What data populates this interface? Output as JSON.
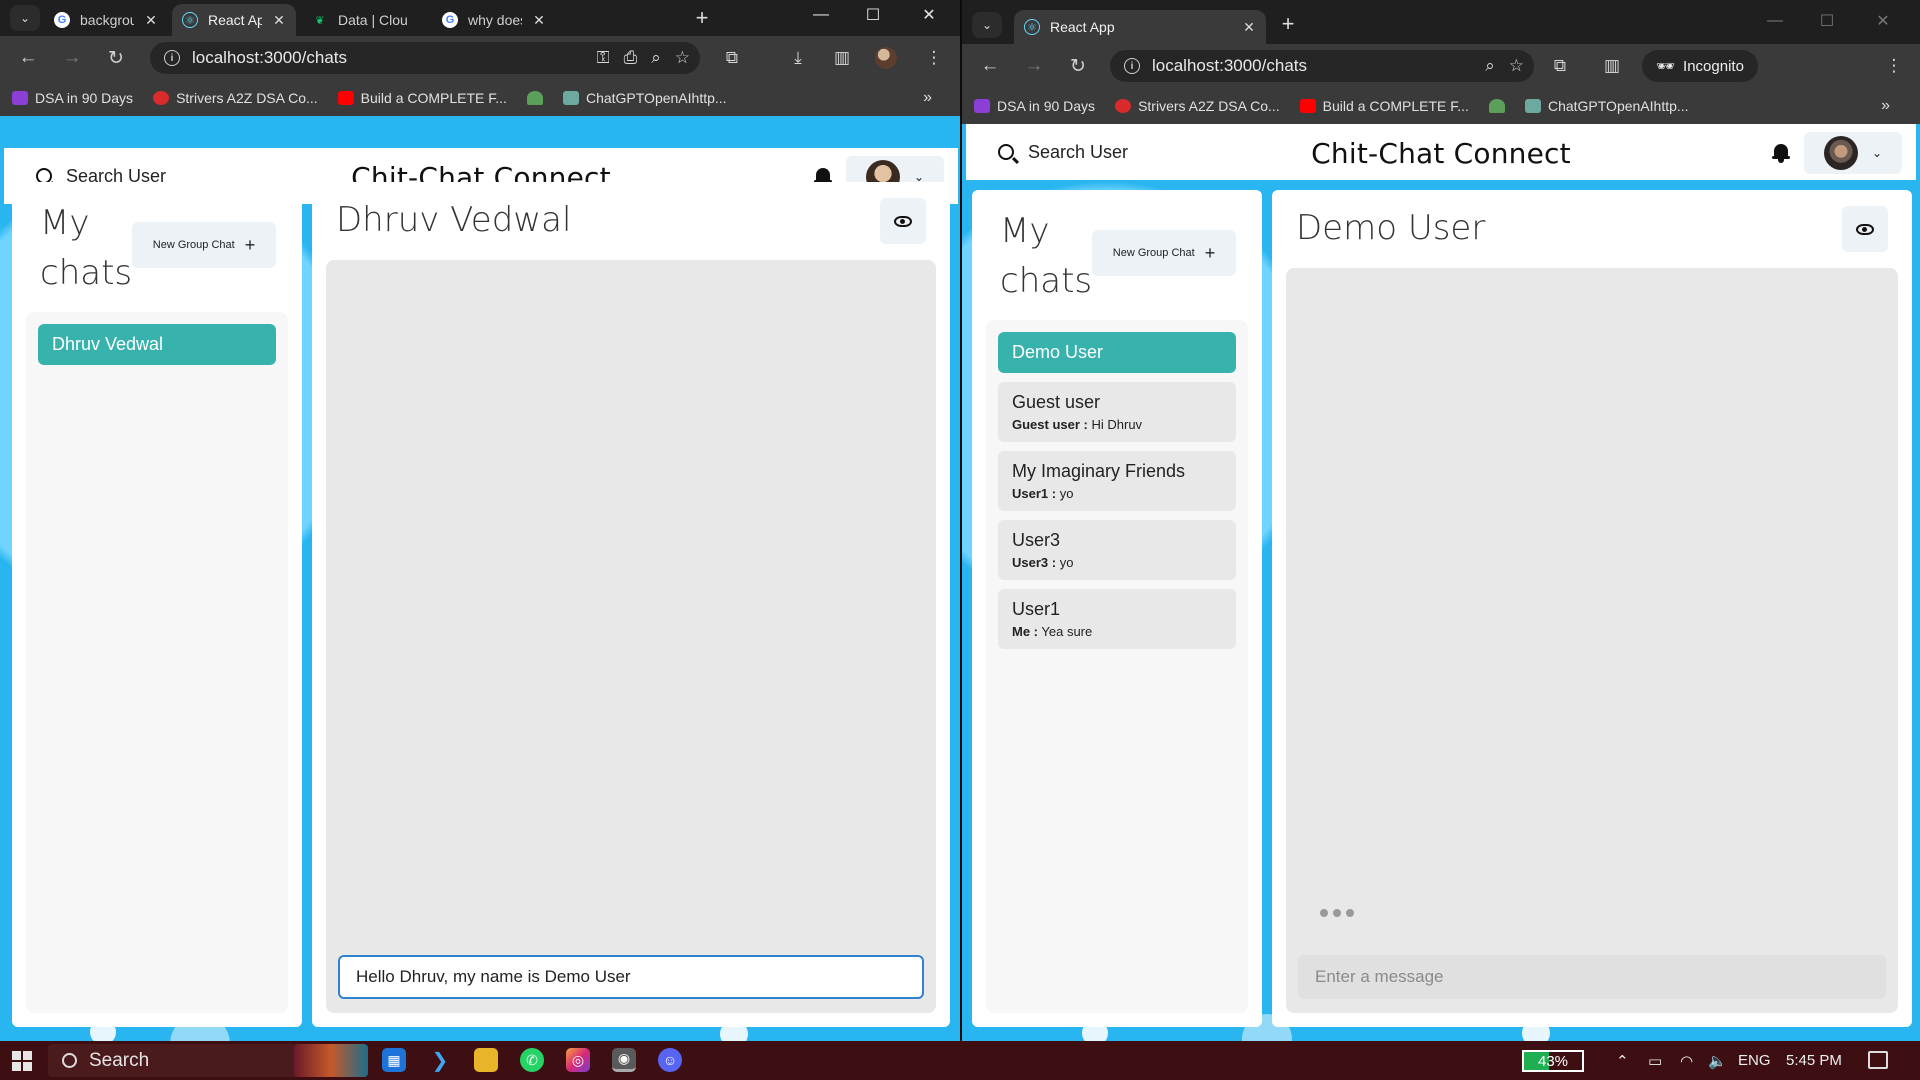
{
  "left_window": {
    "tabs": [
      {
        "title": "backgroun",
        "icon": "google-icon"
      },
      {
        "title": "React App",
        "icon": "react-icon",
        "active": true
      },
      {
        "title": "Data | Clou",
        "icon": "mongodb-icon"
      },
      {
        "title": "why does",
        "icon": "google-icon"
      }
    ],
    "url": "localhost:3000/chats",
    "bookmarks": [
      "DSA in 90 Days",
      "Strivers A2Z DSA Co...",
      "Build a COMPLETE F...",
      "ChatGPTOpenAIhttp..."
    ],
    "app": {
      "search_label": "Search User",
      "title": "Chit-Chat Connect",
      "my_chats_heading": "My chats",
      "new_group_label": "New Group Chat",
      "chats": [
        {
          "name": "Dhruv Vedwal",
          "selected": true
        }
      ],
      "active_chat_title": "Dhruv Vedwal",
      "message_value": "Hello Dhruv, my name is Demo User"
    }
  },
  "right_window": {
    "tabs": [
      {
        "title": "React App",
        "icon": "react-icon",
        "active": true
      }
    ],
    "url": "localhost:3000/chats",
    "incognito_label": "Incognito",
    "bookmarks": [
      "DSA in 90 Days",
      "Strivers A2Z DSA Co...",
      "Build a COMPLETE F...",
      "ChatGPTOpenAIhttp..."
    ],
    "app": {
      "search_label": "Search User",
      "title": "Chit-Chat Connect",
      "my_chats_heading": "My chats",
      "new_group_label": "New Group Chat",
      "chats": [
        {
          "name": "Demo User",
          "selected": true
        },
        {
          "name": "Guest user",
          "sender": "Guest user :",
          "text": "Hi Dhruv"
        },
        {
          "name": "My Imaginary Friends",
          "sender": "User1 :",
          "text": "yo"
        },
        {
          "name": "User3",
          "sender": "User3 :",
          "text": "yo"
        },
        {
          "name": "User1",
          "sender": "Me :",
          "text": "Yea sure"
        }
      ],
      "active_chat_title": "Demo User",
      "message_placeholder": "Enter a message"
    }
  },
  "taskbar": {
    "search_label": "Search",
    "battery": "43%",
    "language": "ENG",
    "time": "5:45 PM"
  },
  "colors": {
    "selected_chat": "#38b2ac",
    "page_background": "#29b5f0",
    "input_focus_border": "#3182ce",
    "taskbar": "#3d0f12"
  }
}
